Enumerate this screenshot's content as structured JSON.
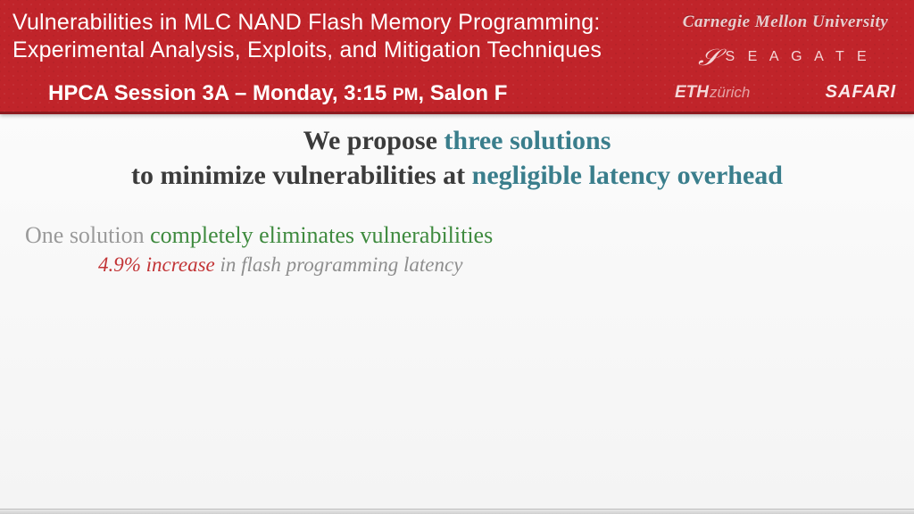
{
  "header": {
    "title_line1": "Vulnerabilities in MLC NAND Flash Memory Programming:",
    "title_line2": "Experimental Analysis, Exploits, and Mitigation Techniques",
    "session_prefix": "HPCA Session 3A – Monday, 3:15 ",
    "session_pm": "PM",
    "session_suffix": ", Salon F"
  },
  "logos": {
    "cmu": "Carnegie Mellon University",
    "seagate_text": "S E A G A T E",
    "eth": "ETH",
    "eth_sub": "zürich",
    "safari": "SAFARI"
  },
  "propose": {
    "l1a": "We propose ",
    "l1b": "three solutions",
    "l2a": "to minimize vulnerabilities at ",
    "l2b": "negligible latency overhead"
  },
  "solution": {
    "lead_gray": "One solution ",
    "lead_green": "completely eliminates vulnerabilities",
    "detail_red": "4.9% increase",
    "detail_rest": " in flash programming latency"
  }
}
